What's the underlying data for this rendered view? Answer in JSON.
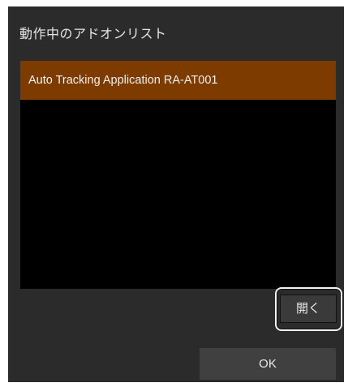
{
  "dialog": {
    "title": "動作中のアドオンリスト",
    "addons": [
      {
        "label": "Auto Tracking Application RA-AT001",
        "selected": true
      }
    ],
    "open_button_label": "開く",
    "ok_button_label": "OK"
  },
  "colors": {
    "dialog_background": "#2b2b2b",
    "list_background": "#000000",
    "selected_item": "#7d3b00",
    "highlight_ring": "#f2f2f2"
  }
}
